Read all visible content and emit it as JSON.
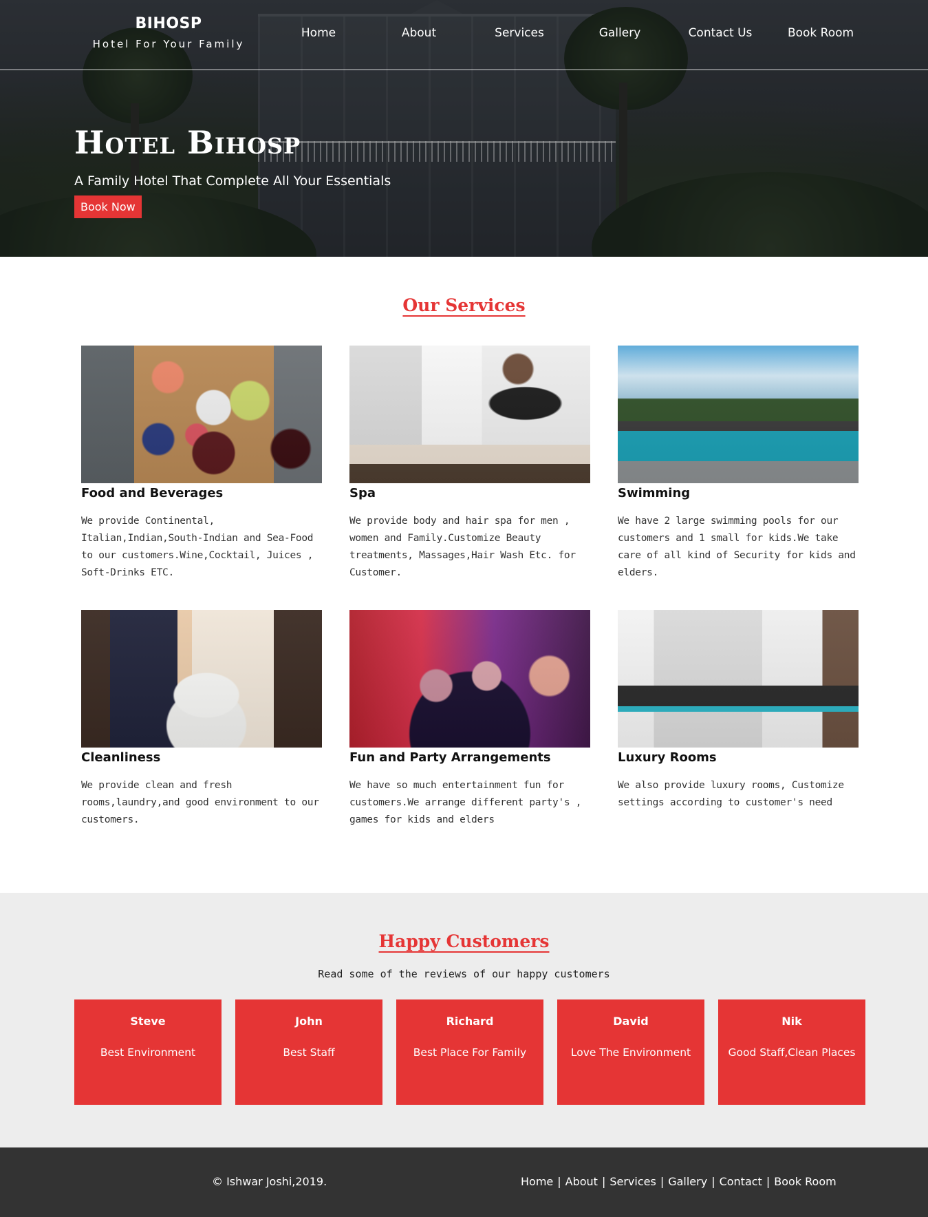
{
  "header": {
    "brand_name": "BIHOSP",
    "brand_tagline": "Hotel For Your Family",
    "nav": [
      "Home",
      "About",
      "Services",
      "Gallery",
      "Contact Us",
      "Book Room"
    ]
  },
  "hero": {
    "title": "Hotel Bihosp",
    "subtitle": "A Family Hotel That Complete All Your Essentials",
    "cta_label": "Book Now"
  },
  "services": {
    "heading": "Our Services",
    "items": [
      {
        "name": "Food and Beverages",
        "desc": "We provide Continental, Italian,Indian,South-Indian and Sea-Food to our customers.Wine,Cocktail, Juices , Soft-Drinks ETC."
      },
      {
        "name": "Spa",
        "desc": "We provide body and hair spa for men , women and Family.Customize Beauty treatments, Massages,Hair Wash Etc. for Customer."
      },
      {
        "name": "Swimming",
        "desc": "We have 2 large swimming pools for our customers and 1 small for kids.We take care of all kind of Security for kids and elders."
      },
      {
        "name": "Cleanliness",
        "desc": "We provide clean and fresh rooms,laundry,and good environment to our customers."
      },
      {
        "name": "Fun and Party Arrangements",
        "desc": "We have so much entertainment fun for customers.We arrange different party's , games for kids and elders"
      },
      {
        "name": "Luxury Rooms",
        "desc": "We also provide luxury rooms, Customize settings according to customer's need"
      }
    ]
  },
  "customers": {
    "heading": "Happy Customers",
    "intro": "Read some of the reviews of our happy customers",
    "reviews": [
      {
        "name": "Steve",
        "text": "Best Environment"
      },
      {
        "name": "John",
        "text": "Best Staff"
      },
      {
        "name": "Richard",
        "text": "Best Place For Family"
      },
      {
        "name": "David",
        "text": "Love The Environment"
      },
      {
        "name": "Nik",
        "text": "Good Staff,Clean Places"
      }
    ]
  },
  "footer": {
    "copyright": "© Ishwar Joshi,2019.",
    "links": [
      "Home",
      "About",
      "Services",
      "Gallery",
      "Contact",
      "Book Room"
    ],
    "separator": "|"
  },
  "colors": {
    "accent": "#e53535",
    "footer_bg": "#333333",
    "customers_bg": "#ededed"
  }
}
